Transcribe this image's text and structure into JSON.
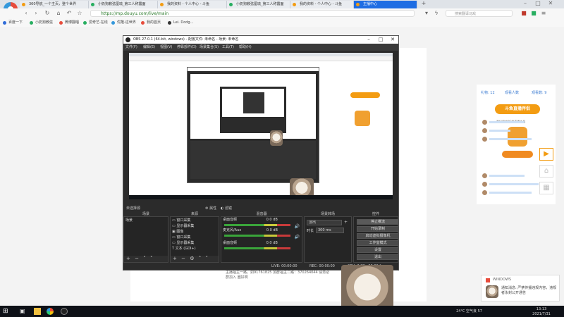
{
  "browser": {
    "tabs": [
      {
        "label": "360导航_一个主页，整个世界"
      },
      {
        "label": "小奶狗教弦厘琉_第三人称露面"
      },
      {
        "label": "我的资料 - 个人中心 - 斗鱼"
      },
      {
        "label": "小奶狗教弦厘琉_第三人称露面"
      },
      {
        "label": "我的资料 - 个人中心 - 斗鱼"
      },
      {
        "label": "主播中心"
      }
    ],
    "url": "https://mp.douyu.com/live/main",
    "search_placeholder": "搜索翻译马戏",
    "bookmarks": [
      {
        "label": "百度一下"
      },
      {
        "label": "小奶狗教弦"
      },
      {
        "label": "微博翻唱"
      },
      {
        "label": "爱奇艺-在线"
      },
      {
        "label": "优酷-这世界"
      },
      {
        "label": "我的首页"
      },
      {
        "label": "Lei. Dodg..."
      }
    ]
  },
  "right_panel": {
    "stats": [
      "礼物: 12",
      "观看人数",
      "观看数: 9"
    ],
    "popular_badge": "斗鱼直播伴侣",
    "popular_sub": "最好用的PC端直播工具"
  },
  "obs": {
    "title": "OBS 27.0.1 (64-bit, windows) - 配置文件: 未命名 - 场景: 未命名",
    "menu": [
      "文件(F)",
      "编辑(E)",
      "视图(V)",
      "停靠部件(D)",
      "场景集合(S)",
      "工具(T)",
      "帮助(H)"
    ],
    "no_source_selected": "未选择源",
    "props_label": "属性",
    "filters_label": "滤镜",
    "docks": {
      "scenes": {
        "title": "场景",
        "items": [
          "场景"
        ]
      },
      "sources": {
        "title": "来源",
        "items": [
          "窗口采集",
          "显示器采集",
          "图像",
          "窗口采集",
          "显示器采集",
          "文本 (GDI+)"
        ]
      },
      "mixer": {
        "title": "混音器",
        "tracks": [
          {
            "name": "桌面音频",
            "level": "0.0 dB"
          },
          {
            "name": "麦克风/Aux",
            "level": "0.0 dB"
          },
          {
            "name": "桌面音频",
            "level": "0.0 dB"
          }
        ]
      },
      "transitions": {
        "title": "场景转场",
        "type": "淡出",
        "duration_label": "时长",
        "duration": "300 ms"
      },
      "controls": {
        "title": "控件",
        "buttons": [
          "停止推流",
          "开始录制",
          "启动虚拟摄像机",
          "工作室模式",
          "设置",
          "退出"
        ]
      }
    },
    "status": {
      "live": "LIVE: 00:00:00",
      "rec": "REC: 00:00:00",
      "cpu": "CPU: 2.2%, 30.00 fps"
    }
  },
  "page_bottom_text": [
    "主播福主一路，如91761825 加群福主二路：370264044 请务必",
    "群加入 圈好啊"
  ],
  "notification": {
    "title": "WINDOWS",
    "text": "通知消息: 严禁传播违规内容，违规者永封公开通告"
  },
  "taskbar": {
    "weather": "24°C 空气良 57",
    "time": "13:13",
    "date": "2021/7/31"
  }
}
